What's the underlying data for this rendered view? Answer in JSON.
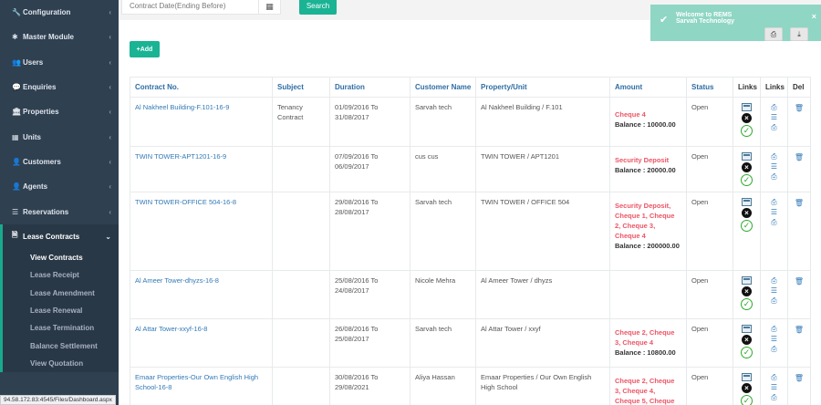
{
  "sidebar": {
    "items": [
      {
        "label": "Configuration",
        "icon": "wrench-icon",
        "glyph": "🔧"
      },
      {
        "label": "Master Module",
        "icon": "asterisk-icon",
        "glyph": "✱"
      },
      {
        "label": "Users",
        "icon": "users-icon",
        "glyph": "👥"
      },
      {
        "label": "Enquiries",
        "icon": "chat-icon",
        "glyph": "💬"
      },
      {
        "label": "Properties",
        "icon": "bank-icon",
        "glyph": "🏛"
      },
      {
        "label": "Units",
        "icon": "building-icon",
        "glyph": "▦"
      },
      {
        "label": "Customers",
        "icon": "user-icon",
        "glyph": "👤"
      },
      {
        "label": "Agents",
        "icon": "agent-icon",
        "glyph": "👤"
      },
      {
        "label": "Reservations",
        "icon": "list-icon",
        "glyph": "☰"
      }
    ],
    "active_section": {
      "label": "Lease Contracts",
      "icon": "document-icon",
      "glyph": "🗎"
    },
    "submenu": [
      "View Contracts",
      "Lease Receipt",
      "Lease Amendment",
      "Lease Renewal",
      "Lease Termination",
      "Balance Settlement",
      "View Quotation"
    ]
  },
  "filter": {
    "date_placeholder": "Contract Date(Ending Before)",
    "search_label": "Search"
  },
  "add_label": "+Add",
  "toast": {
    "line1": "Welcome to REMS",
    "line2": "Sarvah Technology"
  },
  "table": {
    "headers": [
      "Contract No.",
      "Subject",
      "Duration",
      "Customer Name",
      "Property/Unit",
      "Amount",
      "Status",
      "Links",
      "Links",
      "Del"
    ],
    "rows": [
      {
        "contract": "Al Nakheel Building-F.101-16-9",
        "subject": "Tenancy Contract",
        "duration": "01/09/2016 To 31/08/2017",
        "customer": "Sarvah tech",
        "property": "Al Nakheel Building / F.101",
        "amount": "Cheque 4",
        "balance": "Balance : 10000.00",
        "status": "Open"
      },
      {
        "contract": "TWIN TOWER-APT1201-16-9",
        "subject": "",
        "duration": "07/09/2016 To 06/09/2017",
        "customer": "cus cus",
        "property": "TWIN TOWER / APT1201",
        "amount": "Security Deposit",
        "balance": "Balance : 20000.00",
        "status": "Open"
      },
      {
        "contract": "TWIN TOWER-OFFICE 504-16-8",
        "subject": "",
        "duration": "29/08/2016 To 28/08/2017",
        "customer": "Sarvah tech",
        "property": "TWIN TOWER / OFFICE 504",
        "amount": "Security Deposit, Cheque 1, Cheque 2, Cheque 3, Cheque 4",
        "balance": "Balance : 200000.00",
        "status": "Open"
      },
      {
        "contract": "Al Ameer Tower-dhyzs-16-8",
        "subject": "",
        "duration": "25/08/2016 To 24/08/2017",
        "customer": "Nicole Mehra",
        "property": "Al Ameer Tower / dhyzs",
        "amount": "",
        "balance": "",
        "status": "Open"
      },
      {
        "contract": "Al Attar Tower-xxyf-16-8",
        "subject": "",
        "duration": "26/08/2016 To 25/08/2017",
        "customer": "Sarvah tech",
        "property": "Al Attar Tower / xxyf",
        "amount": "Cheque 2, Cheque 3, Cheque 4",
        "balance": "Balance : 10800.00",
        "status": "Open"
      },
      {
        "contract": "Emaar Properties-Our Own English High School-16-8",
        "subject": "",
        "duration": "30/08/2016 To 29/08/2021",
        "customer": "Aliya Hassan",
        "property": "Emaar Properties / Our Own English High School",
        "amount": "Cheque 2, Cheque 3, Cheque 4, Cheque 5, Cheque",
        "balance": "",
        "status": "Open"
      }
    ]
  },
  "statusbar": "94.58.172.83:4545/Files/Dashboard.aspx"
}
